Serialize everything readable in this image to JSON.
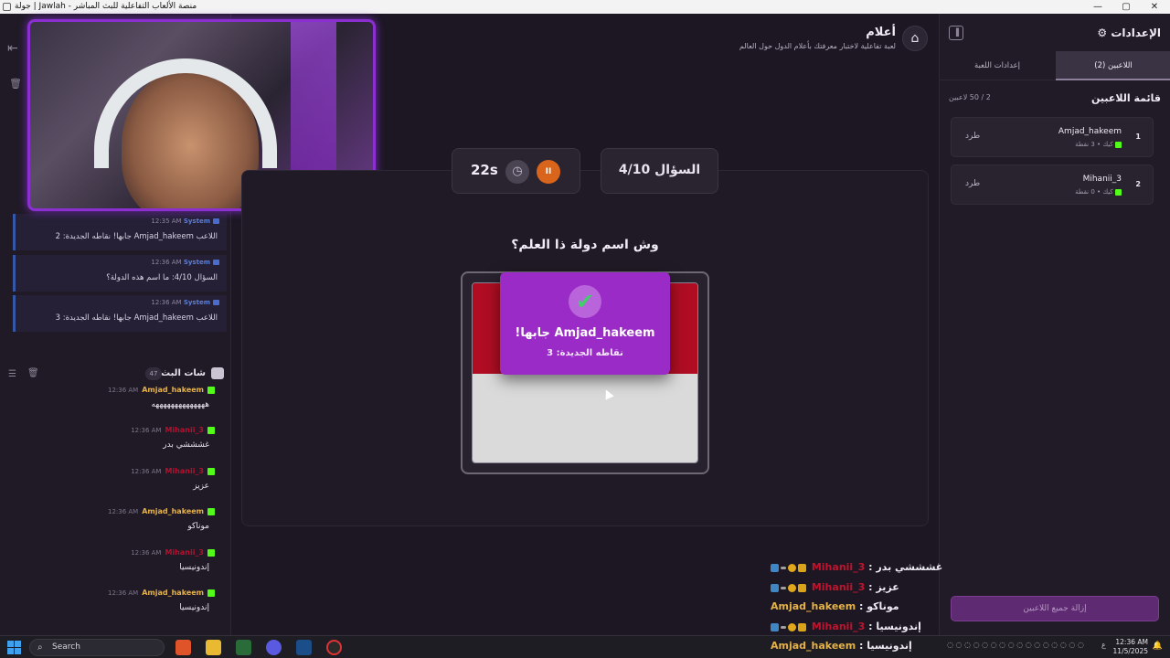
{
  "window": {
    "title": "منصة الألعاب التفاعلية للبث المباشر - Jawlah | جولة",
    "minimize": "—",
    "maximize": "▢",
    "close": "✕"
  },
  "game": {
    "title": "أعلام",
    "subtitle": "لعبة تفاعلية لاختبار معرفتك بأعلام الدول حول العالم",
    "question_counter": "السؤال 4/10",
    "timer": "22s",
    "question": "وش اسم دولة ذا العلم؟",
    "popup_winner": "Amjad_hakeem جابها!",
    "popup_points": "نقاطه الجديدة: 3",
    "flag_colors": [
      "#b00d23",
      "#dadada"
    ]
  },
  "system_messages": [
    {
      "sender": "System",
      "time": "12:35 AM",
      "text": "اللاعب Amjad_hakeem جابها! نقاطه الجديدة: 2"
    },
    {
      "sender": "System",
      "time": "12:36 AM",
      "text": "السؤال 4/10: ما اسم هذه الدولة؟"
    },
    {
      "sender": "System",
      "time": "12:36 AM",
      "text": "اللاعب Amjad_hakeem جابها! نقاطه الجديدة: 3"
    }
  ],
  "stream_chat": {
    "title": "شات البث",
    "count": "47",
    "messages": [
      {
        "user": "Amjad_hakeem",
        "time": "12:36 AM",
        "text": "ههههههههههههههه",
        "color": "gold"
      },
      {
        "user": "Mihanii_3",
        "time": "12:36 AM",
        "text": "غشششي بدر",
        "color": "red"
      },
      {
        "user": "Mihanii_3",
        "time": "12:36 AM",
        "text": "عزيز",
        "color": "red"
      },
      {
        "user": "Amjad_hakeem",
        "time": "12:36 AM",
        "text": "موناكو",
        "color": "gold"
      },
      {
        "user": "Mihanii_3",
        "time": "12:36 AM",
        "text": "إندونيسيا",
        "color": "red"
      },
      {
        "user": "Amjad_hakeem",
        "time": "12:36 AM",
        "text": "إندونيسيا",
        "color": "gold"
      }
    ]
  },
  "settings": {
    "title": "الإعدادات",
    "tab_players": "اللاعبين (2)",
    "tab_game_settings": "إعدادات اللعبة",
    "players_header": "قائمة اللاعبين",
    "players_count": "2 / 50 لاعبين",
    "players": [
      {
        "rank": "1",
        "name": "Amjad_hakeem",
        "meta": "كيك • 3 نقطة",
        "kick": "طرد"
      },
      {
        "rank": "2",
        "name": "Mihanii_3",
        "meta": "كيك • 0 نقطة",
        "kick": "طرد"
      }
    ],
    "remove_all": "إزالة جميع اللاعبين"
  },
  "overlay_chat": [
    {
      "user": "Mihanii_3",
      "text": "غشششي بدر",
      "color": "red",
      "badges": true
    },
    {
      "user": "Mihanii_3",
      "text": "عزيز",
      "color": "red",
      "badges": true
    },
    {
      "user": "Amjad_hakeem",
      "text": "موناكو",
      "color": "gold",
      "badges": false
    },
    {
      "user": "Mihanii_3",
      "text": "إندونيسيا",
      "color": "red",
      "badges": true
    },
    {
      "user": "Amjad_hakeem",
      "text": "إندونيسيا",
      "color": "gold",
      "badges": false
    }
  ],
  "taskbar": {
    "search_placeholder": "Search",
    "time": "12:36 AM",
    "date": "11/5/2025",
    "lang": "ع"
  }
}
